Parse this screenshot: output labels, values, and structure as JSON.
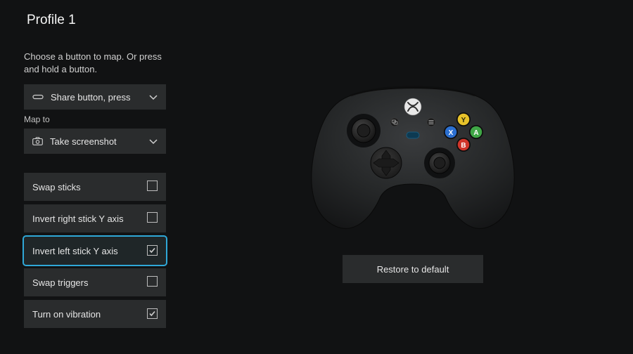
{
  "title": "Profile 1",
  "instruction": "Choose a button to map. Or press and hold a button.",
  "button_dropdown": {
    "value": "Share button, press"
  },
  "map_to_label": "Map to",
  "action_dropdown": {
    "value": "Take screenshot"
  },
  "options": [
    {
      "label": "Swap sticks",
      "checked": false,
      "focused": false
    },
    {
      "label": "Invert right stick Y axis",
      "checked": false,
      "focused": false
    },
    {
      "label": "Invert left stick Y axis",
      "checked": true,
      "focused": true
    },
    {
      "label": "Swap triggers",
      "checked": false,
      "focused": false
    },
    {
      "label": "Turn on vibration",
      "checked": true,
      "focused": false
    }
  ],
  "restore_label": "Restore to default",
  "colors": {
    "bg": "#111213",
    "panel": "#2a2c2d",
    "focus": "#2fa8d8",
    "btn_a": "#3fa646",
    "btn_b": "#d0352a",
    "btn_x": "#2b6fd0",
    "btn_y": "#e7c22a"
  }
}
